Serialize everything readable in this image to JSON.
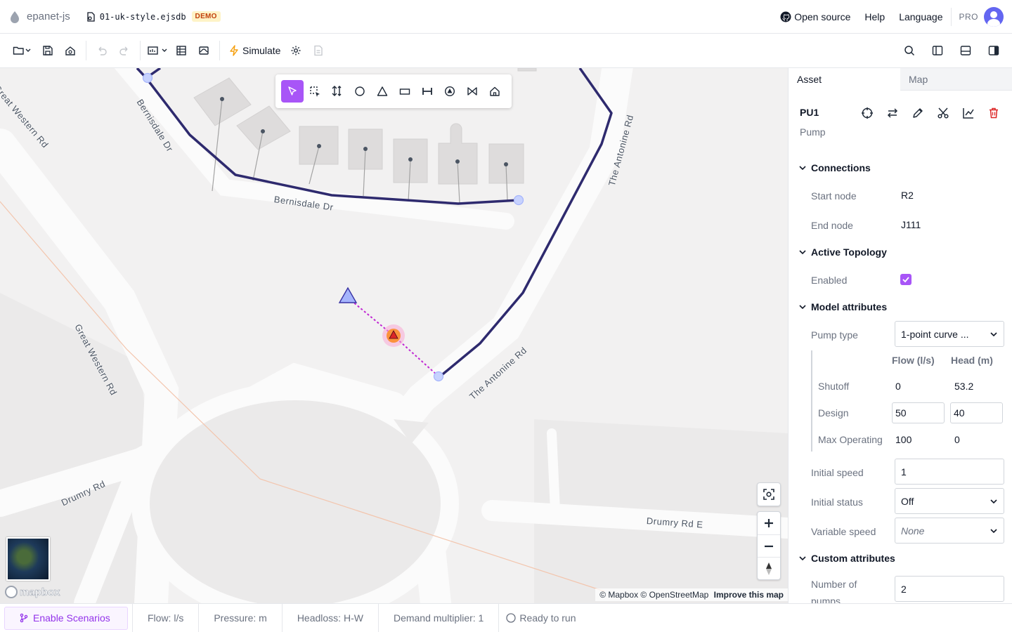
{
  "app": {
    "name": "epanet-js",
    "file_name": "01-uk-style.ejsdb",
    "badge": "DEMO"
  },
  "header": {
    "links": [
      "Open source",
      "Help",
      "Language"
    ],
    "plan": "PRO"
  },
  "toolbar": {
    "left_icons": [
      "folder-icon",
      "save-icon",
      "save-as-icon",
      "undo-icon",
      "redo-icon",
      "import-icon",
      "table-icon",
      "map-layers-icon"
    ],
    "simulate_label": "Simulate",
    "right_icons": [
      "search-icon",
      "left-panel-icon",
      "bottom-panel-icon",
      "right-panel-icon"
    ]
  },
  "map": {
    "draw_tools": [
      "select-tool",
      "lasso-select-tool",
      "reshape-tool",
      "junction-tool",
      "reservoir-tool",
      "tank-tool",
      "pipe-tool",
      "pump-tool",
      "valve-tool",
      "customer-tool"
    ],
    "active_tool": "select-tool",
    "road_labels": [
      "Great Western Rd",
      "Bernisdale Dr",
      "Bernisdale Dr",
      "The Antonine Rd",
      "The Antonine Rd",
      "Great Western Rd",
      "Drumry Rd",
      "Drumry Rd E"
    ],
    "attribution": {
      "text": "© Mapbox © OpenStreetMap",
      "link": "Improve this map"
    },
    "logo": "mapbox",
    "colors": {
      "pipe": "#2e2a6e",
      "selected": "#c026d3",
      "node": "#c7d2fe",
      "road": "#fafafa"
    }
  },
  "panel": {
    "tabs": [
      "Asset",
      "Map"
    ],
    "active_tab": "Asset",
    "asset": {
      "id": "PU1",
      "type": "Pump"
    },
    "sections": {
      "connections": {
        "title": "Connections",
        "start_node_label": "Start node",
        "start_node": "R2",
        "end_node_label": "End node",
        "end_node": "J111"
      },
      "topology": {
        "title": "Active Topology",
        "enabled_label": "Enabled",
        "enabled": true
      },
      "model": {
        "title": "Model attributes",
        "pump_type_label": "Pump type",
        "pump_type": "1-point curve ...",
        "curve": {
          "headers": [
            "Flow (l/s)",
            "Head (m)"
          ],
          "rows": [
            {
              "label": "Shutoff",
              "flow": "0",
              "head": "53.2"
            },
            {
              "label": "Design",
              "flow": "50",
              "head": "40"
            },
            {
              "label": "Max Operating",
              "flow": "100",
              "head": "0"
            }
          ]
        },
        "initial_speed_label": "Initial speed",
        "initial_speed": "1",
        "initial_status_label": "Initial status",
        "initial_status": "Off",
        "variable_speed_label": "Variable speed",
        "variable_speed": "None"
      },
      "custom": {
        "title": "Custom attributes",
        "pumps_label": "Number of pumps",
        "pumps": "2"
      }
    }
  },
  "statusbar": {
    "scenarios": "Enable Scenarios",
    "flow": "Flow: l/s",
    "pressure": "Pressure: m",
    "headloss": "Headloss: H-W",
    "demand": "Demand multiplier: 1",
    "run_state": "Ready to run"
  }
}
